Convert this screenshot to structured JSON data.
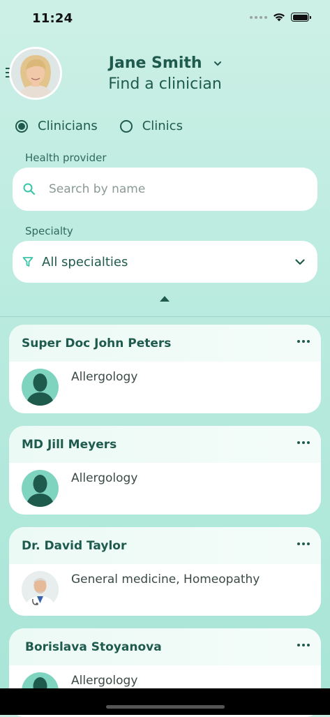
{
  "status_bar": {
    "time": "11:24"
  },
  "header": {
    "user_name": "Jane Smith",
    "title": "Find a clinician"
  },
  "filter_type": {
    "options": [
      {
        "label": "Clinicians",
        "selected": true
      },
      {
        "label": "Clinics",
        "selected": false
      }
    ]
  },
  "search": {
    "label": "Health provider",
    "placeholder": "Search by name",
    "value": ""
  },
  "specialty": {
    "label": "Specialty",
    "value": "All specialties"
  },
  "clinicians": [
    {
      "name": "Super Doc John Peters",
      "specialty": "Allergology",
      "avatar": "placeholder-person-icon"
    },
    {
      "name": "MD Jill Meyers",
      "specialty": "Allergology",
      "avatar": "placeholder-person-icon"
    },
    {
      "name": "Dr. David Taylor",
      "specialty": "General medicine, Homeopathy",
      "avatar": "photo"
    },
    {
      "name": "Borislava Stoyanova",
      "specialty": "Allergology",
      "avatar": "placeholder-person-icon"
    }
  ],
  "colors": {
    "primary": "#1e5b4d",
    "accent": "#3cc4a8",
    "avatar_bg": "#7fd4c0"
  }
}
